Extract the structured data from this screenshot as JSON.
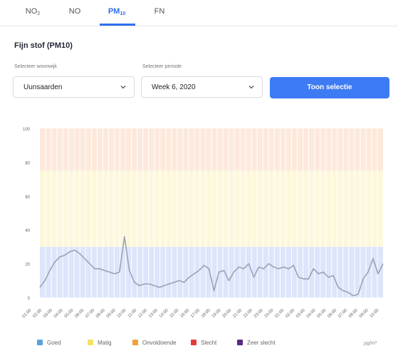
{
  "tabs": [
    {
      "label": "NO",
      "sub": "2",
      "active": false
    },
    {
      "label": "NO",
      "sub": "",
      "active": false
    },
    {
      "label": "PM",
      "sub": "10",
      "active": true
    },
    {
      "label": "FN",
      "sub": "",
      "active": false
    }
  ],
  "title": "Fijn stof (PM10)",
  "filters": {
    "area_label": "Selecteer woonwijk",
    "area_value": "Uunsaarden",
    "period_label": "Selecteer periode",
    "period_value": "Week 6, 2020",
    "submit_label": "Toon selectie"
  },
  "chart_data": {
    "type": "line",
    "ylim": [
      0,
      100
    ],
    "yticks": [
      0,
      20,
      40,
      60,
      80,
      100
    ],
    "bands": [
      {
        "from": 0,
        "to": 30,
        "color": "#dde5fb"
      },
      {
        "from": 30,
        "to": 75,
        "color": "#fdf8dc"
      },
      {
        "from": 75,
        "to": 100,
        "color": "#fde9dc"
      }
    ],
    "xticks": [
      "01:00",
      "02:00",
      "03:00",
      "04:00",
      "05:00",
      "06:00",
      "07:00",
      "08:00",
      "09:00",
      "10:00",
      "11:00",
      "12:00",
      "13:00",
      "14:00",
      "15:00",
      "16:00",
      "17:00",
      "18:00",
      "19:00",
      "20:00",
      "21:00",
      "22:00",
      "23:00",
      "24:00",
      "01:00",
      "02:00",
      "03:00",
      "04:00",
      "05:00",
      "06:00",
      "07:00",
      "08:00",
      "09:00",
      "10:00"
    ],
    "series": [
      {
        "color": "#9aa2b3",
        "values": [
          6,
          10,
          16,
          21,
          24,
          25,
          27,
          28,
          26,
          23,
          20,
          17,
          17,
          16,
          15,
          14,
          15,
          36,
          16,
          9,
          7,
          8,
          8,
          7,
          6,
          7,
          8,
          9,
          10,
          9,
          12,
          14,
          16,
          19,
          17,
          4,
          15,
          16,
          10,
          15,
          18,
          17,
          20,
          12,
          18,
          17,
          20,
          18,
          17,
          18,
          17,
          19,
          12,
          11,
          11,
          17,
          14,
          15,
          12,
          13,
          6,
          4,
          3,
          1,
          2,
          11,
          15,
          23,
          14,
          20
        ]
      }
    ]
  },
  "legend": [
    {
      "label": "Goed",
      "color": "#5aa2e0"
    },
    {
      "label": "Matig",
      "color": "#f4e264"
    },
    {
      "label": "Onvoldoende",
      "color": "#f0a23a"
    },
    {
      "label": "Slecht",
      "color": "#e23b3b"
    },
    {
      "label": "Zeer slecht",
      "color": "#5a2a86"
    }
  ],
  "unit": "µg/m³"
}
